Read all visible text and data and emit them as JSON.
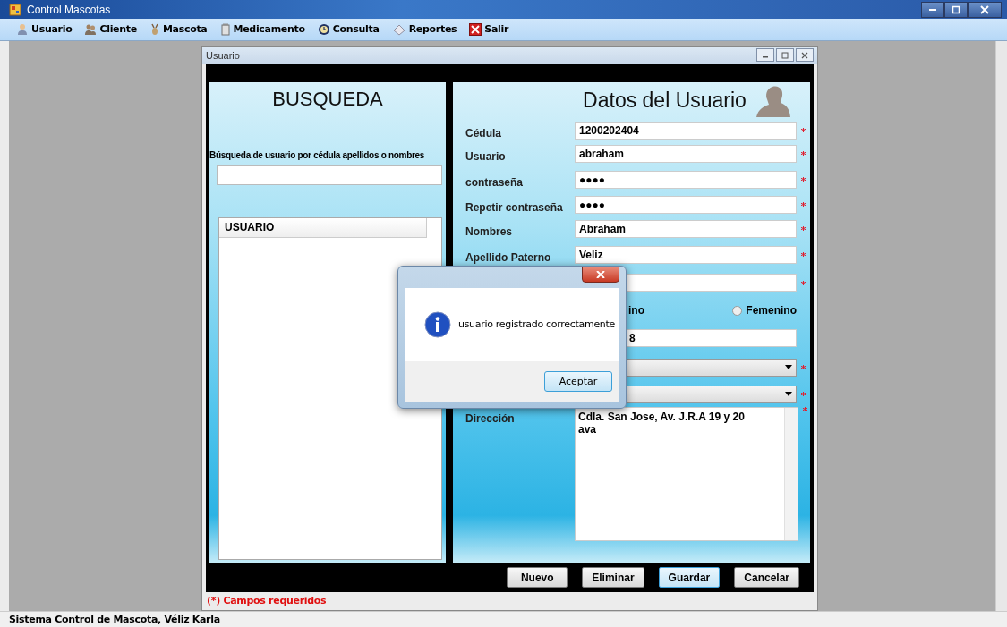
{
  "window": {
    "title": "Control Mascotas"
  },
  "menu": [
    {
      "label": "Usuario"
    },
    {
      "label": "Cliente"
    },
    {
      "label": "Mascota"
    },
    {
      "label": "Medicamento"
    },
    {
      "label": "Consulta"
    },
    {
      "label": "Reportes"
    },
    {
      "label": "Salir"
    }
  ],
  "child_window": {
    "title": "Usuario",
    "search": {
      "heading": "BUSQUEDA",
      "label": "Búsqueda de usuario por cédula apellidos o nombres",
      "list_column": "USUARIO"
    },
    "form": {
      "heading": "Datos del Usuario",
      "rows": [
        {
          "kind": "text",
          "label": "Cédula",
          "value": "1200202404",
          "required": true
        },
        {
          "kind": "text",
          "label": "Usuario",
          "value": "abraham",
          "required": true
        },
        {
          "kind": "text",
          "label": "contraseña",
          "value": "●●●●",
          "required": true
        },
        {
          "kind": "text",
          "label": "Repetir contraseña",
          "value": "●●●●",
          "required": true
        },
        {
          "kind": "text",
          "label": "Nombres",
          "value": "Abraham",
          "required": true
        },
        {
          "kind": "text",
          "label": "Apellido Paterno",
          "value": "Veliz",
          "required": true
        },
        {
          "kind": "text",
          "label": "",
          "value": "",
          "required": true
        },
        {
          "kind": "radio",
          "covered_text": "ino",
          "options": [
            {
              "label": "Femenino",
              "selected": false
            }
          ]
        },
        {
          "kind": "text",
          "label": "",
          "value": "8"
        },
        {
          "kind": "combo",
          "label": "",
          "value": "",
          "required": true
        },
        {
          "kind": "combo",
          "label": "",
          "value": "",
          "required": true
        },
        {
          "kind": "textarea",
          "label": "Dirección",
          "value": "Cdla. San Jose, Av. J.R.A 19 y 20 ava",
          "required": true
        }
      ]
    },
    "buttons": [
      {
        "label": "Nuevo",
        "selected": false
      },
      {
        "label": "Eliminar",
        "selected": false
      },
      {
        "label": "Guardar",
        "selected": true
      },
      {
        "label": "Cancelar",
        "selected": false
      }
    ],
    "footer": "(*) Campos requeridos"
  },
  "dialog": {
    "message": "usuario registrado correctamente",
    "button": "Aceptar"
  },
  "status_bar": "Sistema Control de Mascota, Véliz Karla"
}
